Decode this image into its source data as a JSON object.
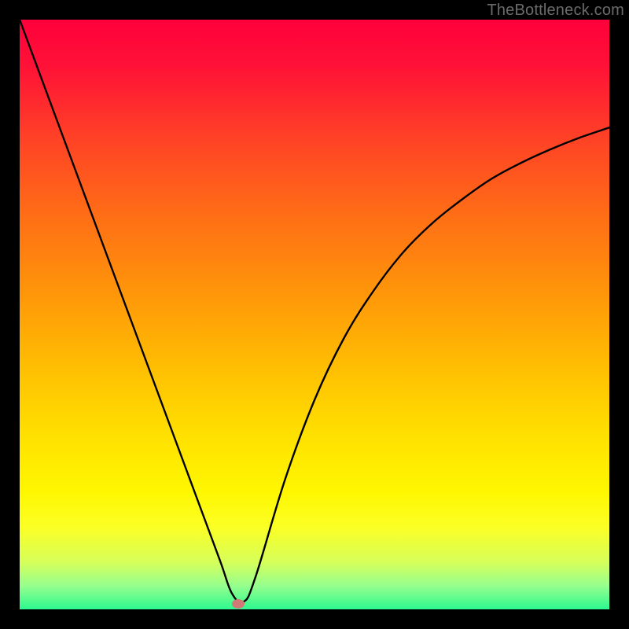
{
  "watermark": "TheBottleneck.com",
  "chart_data": {
    "type": "line",
    "title": "",
    "xlabel": "",
    "ylabel": "",
    "xlim": [
      0,
      100
    ],
    "ylim": [
      0,
      100
    ],
    "grid": false,
    "legend": false,
    "series": [
      {
        "name": "curve",
        "x": [
          0,
          5,
          10,
          15,
          20,
          25,
          30,
          34,
          36,
          38,
          40,
          45,
          50,
          55,
          60,
          65,
          70,
          75,
          80,
          85,
          90,
          95,
          100
        ],
        "values": [
          100,
          86.5,
          73,
          59.5,
          46,
          32.5,
          19,
          8.2,
          2.7,
          1.3,
          5.5,
          22,
          35.5,
          46,
          54,
          60.5,
          65.5,
          69.5,
          73,
          75.7,
          78,
          80,
          81.7
        ]
      }
    ],
    "marker": {
      "x": 37,
      "y": 1.0
    },
    "background_gradient": {
      "stops": [
        {
          "offset": 0,
          "color": "#ff003b"
        },
        {
          "offset": 0.08,
          "color": "#ff1237"
        },
        {
          "offset": 0.2,
          "color": "#ff4126"
        },
        {
          "offset": 0.33,
          "color": "#ff6d16"
        },
        {
          "offset": 0.47,
          "color": "#ff9809"
        },
        {
          "offset": 0.58,
          "color": "#ffbb02"
        },
        {
          "offset": 0.7,
          "color": "#ffdf00"
        },
        {
          "offset": 0.8,
          "color": "#fff700"
        },
        {
          "offset": 0.86,
          "color": "#fbff24"
        },
        {
          "offset": 0.92,
          "color": "#d6ff5a"
        },
        {
          "offset": 0.96,
          "color": "#96ff8e"
        },
        {
          "offset": 1.0,
          "color": "#2cf98f"
        }
      ]
    }
  }
}
